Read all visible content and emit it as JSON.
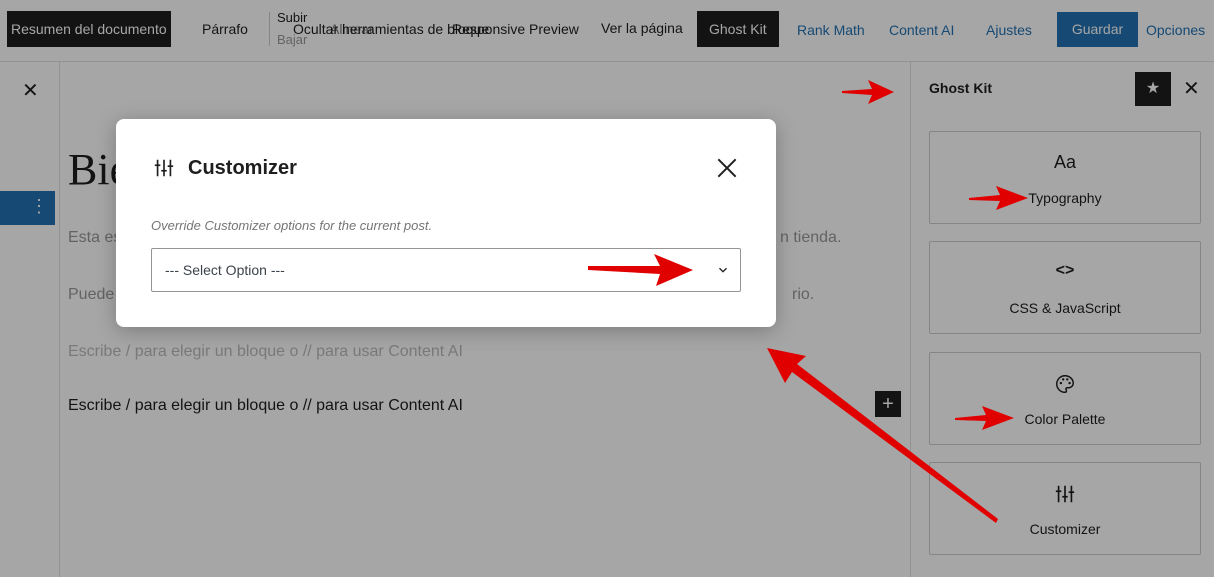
{
  "toolbar": {
    "resumen": "Resumen del documento",
    "parrafo": "Párrafo",
    "subir": "Subir",
    "bajar": "Bajar",
    "ocultar_herramientas": "Ocultar herramientas de bloque",
    "alinear": "Alinear",
    "responsive_preview": "Responsive Preview",
    "ver_pagina": "Ver la página",
    "ghost_kit": "Ghost Kit",
    "rank_math": "Rank Math",
    "content_ai": "Content AI",
    "ajustes": "Ajustes",
    "guardar": "Guardar",
    "opciones": "Opciones"
  },
  "editor": {
    "title_partial": "Bie",
    "line1_start": "Esta es",
    "line1_end": "n tienda.",
    "line2_start": "Puede",
    "line2_end": "rio.",
    "placeholder_faded": "Escribe / para elegir un bloque o // para usar Content AI",
    "placeholder": "Escribe / para elegir un bloque o // para usar Content AI"
  },
  "right_panel": {
    "title": "Ghost Kit",
    "cards": [
      {
        "icon": "typography-icon",
        "glyph": "Aa",
        "label": "Typography"
      },
      {
        "icon": "code-icon",
        "glyph": "<>",
        "label": "CSS & JavaScript"
      },
      {
        "icon": "palette-icon",
        "glyph": "",
        "label": "Color Palette"
      },
      {
        "icon": "sliders-icon",
        "glyph": "",
        "label": "Customizer"
      }
    ]
  },
  "modal": {
    "title": "Customizer",
    "help": "Override Customizer options for the current post.",
    "select_value": "--- Select Option ---"
  },
  "colors": {
    "accent": "#2271b1",
    "dark": "#1e1e1e",
    "annotation_arrow": "#e00000"
  }
}
